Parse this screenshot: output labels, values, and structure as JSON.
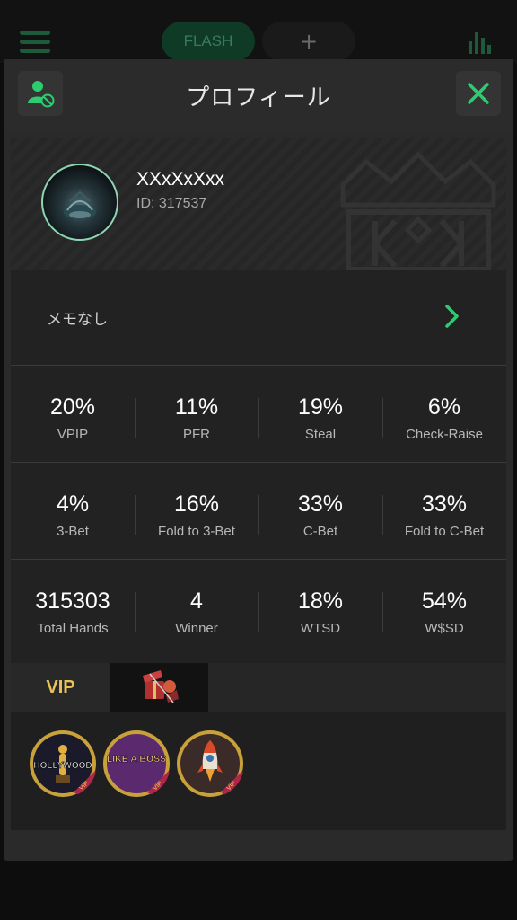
{
  "topbar": {
    "tabs": [
      {
        "label": "FLASH",
        "active": true
      },
      {
        "label": "+",
        "active": false
      }
    ],
    "icons": [
      "menu-icon",
      "stats-bars-icon"
    ]
  },
  "modal": {
    "title": "プロフィール",
    "left_icon": "user-block-icon",
    "close_icon": "close-icon"
  },
  "profile": {
    "username": "XXxXxXxx",
    "id": "ID: 317537"
  },
  "memo": {
    "label": "メモなし",
    "icon": "chevron-right-icon"
  },
  "stats": [
    [
      {
        "value": "20%",
        "label": "VPIP"
      },
      {
        "value": "11%",
        "label": "PFR"
      },
      {
        "value": "19%",
        "label": "Steal"
      },
      {
        "value": "6%",
        "label": "Check-Raise"
      }
    ],
    [
      {
        "value": "4%",
        "label": "3-Bet"
      },
      {
        "value": "16%",
        "label": "Fold to 3-Bet"
      },
      {
        "value": "33%",
        "label": "C-Bet"
      },
      {
        "value": "33%",
        "label": "Fold to C-Bet"
      }
    ],
    [
      {
        "value": "315303",
        "label": "Total Hands"
      },
      {
        "value": "4",
        "label": "Winner"
      },
      {
        "value": "18%",
        "label": "WTSD"
      },
      {
        "value": "54%",
        "label": "W$SD"
      }
    ]
  ],
  "vip_tabs": [
    {
      "label": "VIP",
      "active": true
    },
    {
      "label": "",
      "icon": "gift-item-icon",
      "active": false
    }
  ],
  "badges": [
    {
      "text": "HOLLYWOOD",
      "tag": "VIP",
      "icon": "oscar-statue-icon"
    },
    {
      "text": "LIKE A BOSS",
      "tag": "VIP",
      "icon": "like-a-boss-icon"
    },
    {
      "text": "",
      "tag": "VIP",
      "icon": "rocket-icon"
    }
  ],
  "colors": {
    "accent_green": "#2ecc71",
    "vip_gold": "#e8c35a",
    "badge_ring": "#c9a13a",
    "vip_ribbon": "#b0254a"
  }
}
